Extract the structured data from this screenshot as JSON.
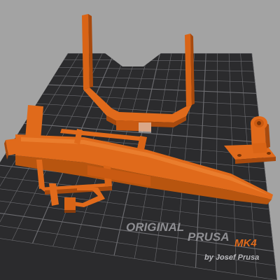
{
  "viewport": {
    "background": "#a3a3a3",
    "bed_color": "#2b2b2d",
    "grid_color": "#6e6e72",
    "part_color": "#e06a1b",
    "part_shadow": "#a84a0e",
    "part_highlight": "#f08a3a"
  },
  "bed_branding": {
    "word_original": "ORIGINAL",
    "word_prusa": "PRUSA",
    "word_model": "MK4",
    "byline": "by Josef Prusa"
  },
  "objects": [
    {
      "name": "u-shaped-bracket"
    },
    {
      "name": "long-arm-frame"
    },
    {
      "name": "small-mount"
    }
  ]
}
